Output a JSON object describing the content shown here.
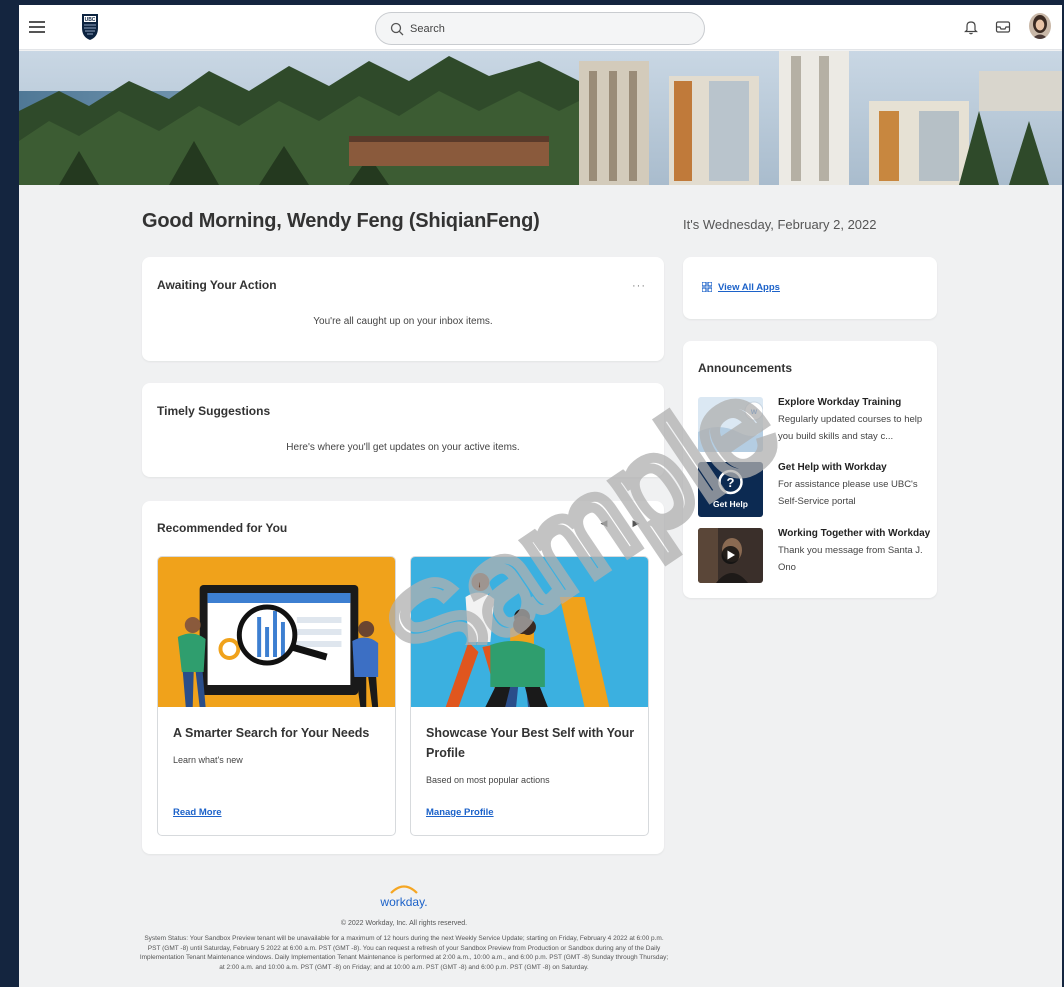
{
  "header": {
    "logo_text": "UBC",
    "search_placeholder": "Search",
    "icons": [
      "menu-icon",
      "search-icon",
      "bell-icon",
      "inbox-icon",
      "avatar"
    ]
  },
  "greeting": "Good Morning, Wendy Feng   (ShiqianFeng)",
  "date": "It's Wednesday, February 2, 2022",
  "awaiting": {
    "title": "Awaiting Your Action",
    "message": "You're all caught up on your inbox items.",
    "more": "···"
  },
  "timely": {
    "title": "Timely Suggestions",
    "message": "Here's where you'll get updates on your active items."
  },
  "recommended": {
    "title": "Recommended for You",
    "prev": "◀",
    "next": "▶",
    "cards": [
      {
        "title": "A Smarter Search for Your Needs",
        "subtitle": "Learn what's new",
        "link": "Read More"
      },
      {
        "title": "Showcase Your Best Self with Your Profile",
        "subtitle": "Based on most popular actions",
        "link": "Manage Profile"
      }
    ]
  },
  "apps": {
    "link": "View All Apps"
  },
  "announcements": {
    "title": "Announcements",
    "items": [
      {
        "title": "Explore Workday Training",
        "desc": "Regularly updated courses to help you build skills and stay c..."
      },
      {
        "title": "Get Help with Workday",
        "desc": "For assistance please use UBC's Self-Service portal",
        "thumb_text": "Get Help"
      },
      {
        "title": "Working Together with Workday",
        "desc": "Thank you message from Santa J. Ono"
      }
    ]
  },
  "footer": {
    "brand": "workday.",
    "copyright": "© 2022 Workday, Inc. All rights reserved.",
    "status": "System Status: Your Sandbox Preview tenant will be unavailable for a maximum of 12 hours during the next Weekly Service Update; starting on Friday, February 4 2022 at 6:00 p.m. PST (GMT -8) until Saturday, February 5 2022 at 6:00 a.m. PST (GMT -8). You can request a refresh of your Sandbox Preview from Production or Sandbox during any of the Daily Implementation Tenant Maintenance windows. Daily Implementation Tenant Maintenance is performed at 2:00 a.m., 10:00 a.m., and 6:00 p.m. PST (GMT -8) Sunday through Thursday; at 2:00 a.m. and 10:00 a.m. PST (GMT -8) on Friday; and at 10:00 a.m. PST (GMT -8) and 6:00 p.m. PST (GMT -8) on Saturday."
  },
  "watermark": "Sample",
  "colors": {
    "page_bg": "#14253f",
    "content_bg": "#f0f1f2",
    "link": "#1c62c9",
    "rec_orange": "#f0a21b",
    "rec_blue": "#3bb0e0",
    "workday_orange": "#f5a623"
  }
}
